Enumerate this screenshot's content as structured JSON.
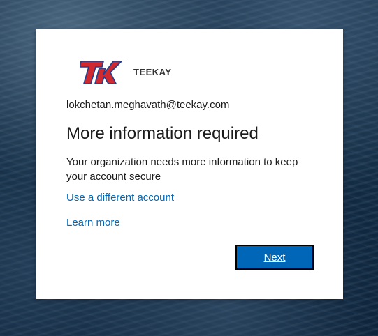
{
  "brand": {
    "name": "TEEKAY",
    "logo_letters": "TK",
    "colors": {
      "logo_red": "#cf2a2f",
      "logo_navy": "#1f3f8f"
    }
  },
  "signin": {
    "email": "lokchetan.meghavath@teekay.com",
    "title": "More information required",
    "description": "Your organization needs more information to keep your account secure",
    "use_different_account_label": "Use a different account",
    "learn_more_label": "Learn more",
    "next_label": "Next"
  },
  "colors": {
    "link": "#0067b8",
    "primary_button": "#0067b8"
  }
}
